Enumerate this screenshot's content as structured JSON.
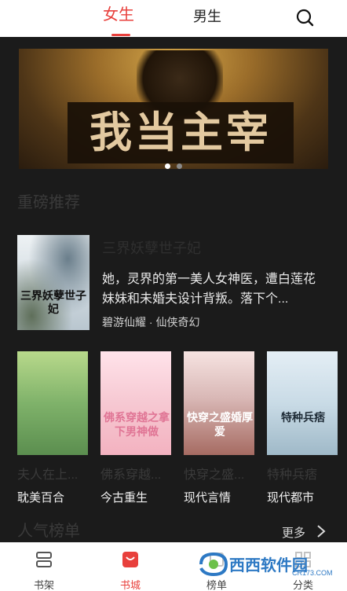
{
  "top_tabs": [
    {
      "label": "女生",
      "active": true
    },
    {
      "label": "男生",
      "active": false
    }
  ],
  "search_icon": "search-icon",
  "banner": {
    "title": "我当主宰",
    "dots": [
      true,
      false
    ]
  },
  "sections": {
    "featured": "重磅推荐",
    "popular": "人气榜单",
    "more_label": "更多"
  },
  "featured_book": {
    "cover_text": "三界妖孽世子妃",
    "title": "三界妖孽世子妃",
    "desc": "她，灵界的第一美人女神医，遭白莲花妹妹和未婚夫设计背叛。落下个...",
    "meta": "碧游仙耀 · 仙侠奇幻"
  },
  "grid_books": [
    {
      "title": "夫人在上...",
      "tag": "耽美百合",
      "cover_text": ""
    },
    {
      "title": "佛系穿越...",
      "tag": "今古重生",
      "cover_text": "佛系穿越之拿下男神做"
    },
    {
      "title": "快穿之盛...",
      "tag": "现代言情",
      "cover_text": "快穿之盛婚厚爱"
    },
    {
      "title": "特种兵痞",
      "tag": "现代都市",
      "cover_text": "特种兵痞"
    }
  ],
  "bottom_nav": [
    {
      "label": "书架",
      "icon": "bookshelf-icon",
      "active": false
    },
    {
      "label": "书城",
      "icon": "bookstore-icon",
      "active": true
    },
    {
      "label": "榜单",
      "icon": "ranking-icon",
      "active": false
    },
    {
      "label": "分类",
      "icon": "category-icon",
      "active": false
    }
  ],
  "watermark": {
    "text": "西西软件园",
    "sub": "CR173.COM"
  },
  "colors": {
    "accent": "#e8403c",
    "background": "#1b1b1b"
  }
}
